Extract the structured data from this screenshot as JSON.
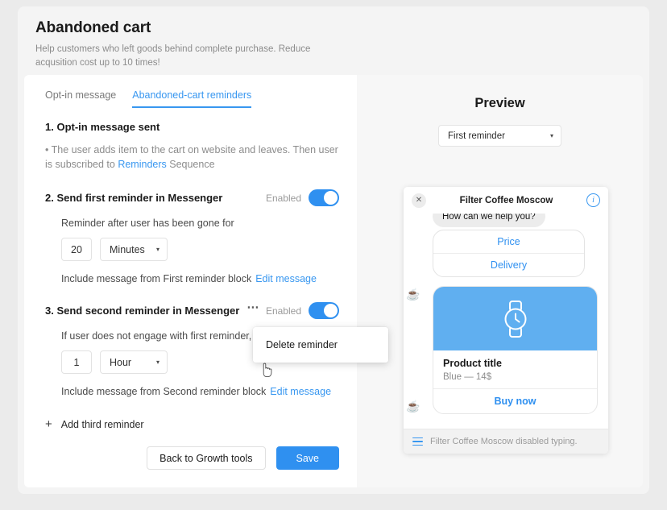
{
  "page": {
    "title": "Abandoned cart",
    "subtitle": "Help customers who left goods behind complete purchase. Reduce acqusition cost up to 10 times!"
  },
  "tabs": [
    {
      "label": "Opt-in message",
      "active": false
    },
    {
      "label": "Abandoned-cart reminders",
      "active": true
    }
  ],
  "steps": {
    "step1": {
      "title": "1. Opt-in message sent",
      "desc_prefix": "• The user adds item to the cart on website and leaves. Then user is subscribed to ",
      "desc_link": "Reminders",
      "desc_suffix": " Sequence"
    },
    "step2": {
      "title": "2. Send first reminder in Messenger",
      "enabled_label": "Enabled",
      "enabled": true,
      "sub_text": "Reminder after user has been gone for",
      "amount": "20",
      "unit": "Minutes",
      "include_text": "Include message from First reminder block",
      "edit_link": "Edit message"
    },
    "step3": {
      "title": "3. Send second reminder in Messenger",
      "dots": "⋯",
      "enabled_label": "Enabled",
      "enabled": true,
      "sub_text": "If user does not engage with first reminder, se",
      "amount": "1",
      "unit": "Hour",
      "include_text": "Include message from Second reminder block",
      "edit_link": "Edit message"
    },
    "add_third": {
      "plus": "+",
      "label": "Add third reminder"
    }
  },
  "context_menu": {
    "items": [
      {
        "label": "Delete reminder"
      }
    ]
  },
  "footer": {
    "back_label": "Back to Growth tools",
    "save_label": "Save"
  },
  "preview": {
    "title": "Preview",
    "selected_option": "First reminder",
    "caret": "▾",
    "phone": {
      "close_glyph": "✕",
      "title": "Filter Coffee Moscow",
      "info_glyph": "i",
      "bubble_text": "How can we help you?",
      "avatar_glyph": "☕",
      "quick_replies": [
        {
          "label": "Price"
        },
        {
          "label": "Delivery"
        }
      ],
      "product": {
        "title": "Product title",
        "subtitle": "Blue — 14$",
        "buy_label": "Buy now"
      },
      "footer_text": "Filter Coffee Moscow disabled typing."
    }
  },
  "colors": {
    "accent_blue": "#2f90f0",
    "link_blue": "#3897f0",
    "product_img_blue": "#60aff0",
    "page_bg": "#ebebeb",
    "card_bg": "#f4f4f4"
  }
}
